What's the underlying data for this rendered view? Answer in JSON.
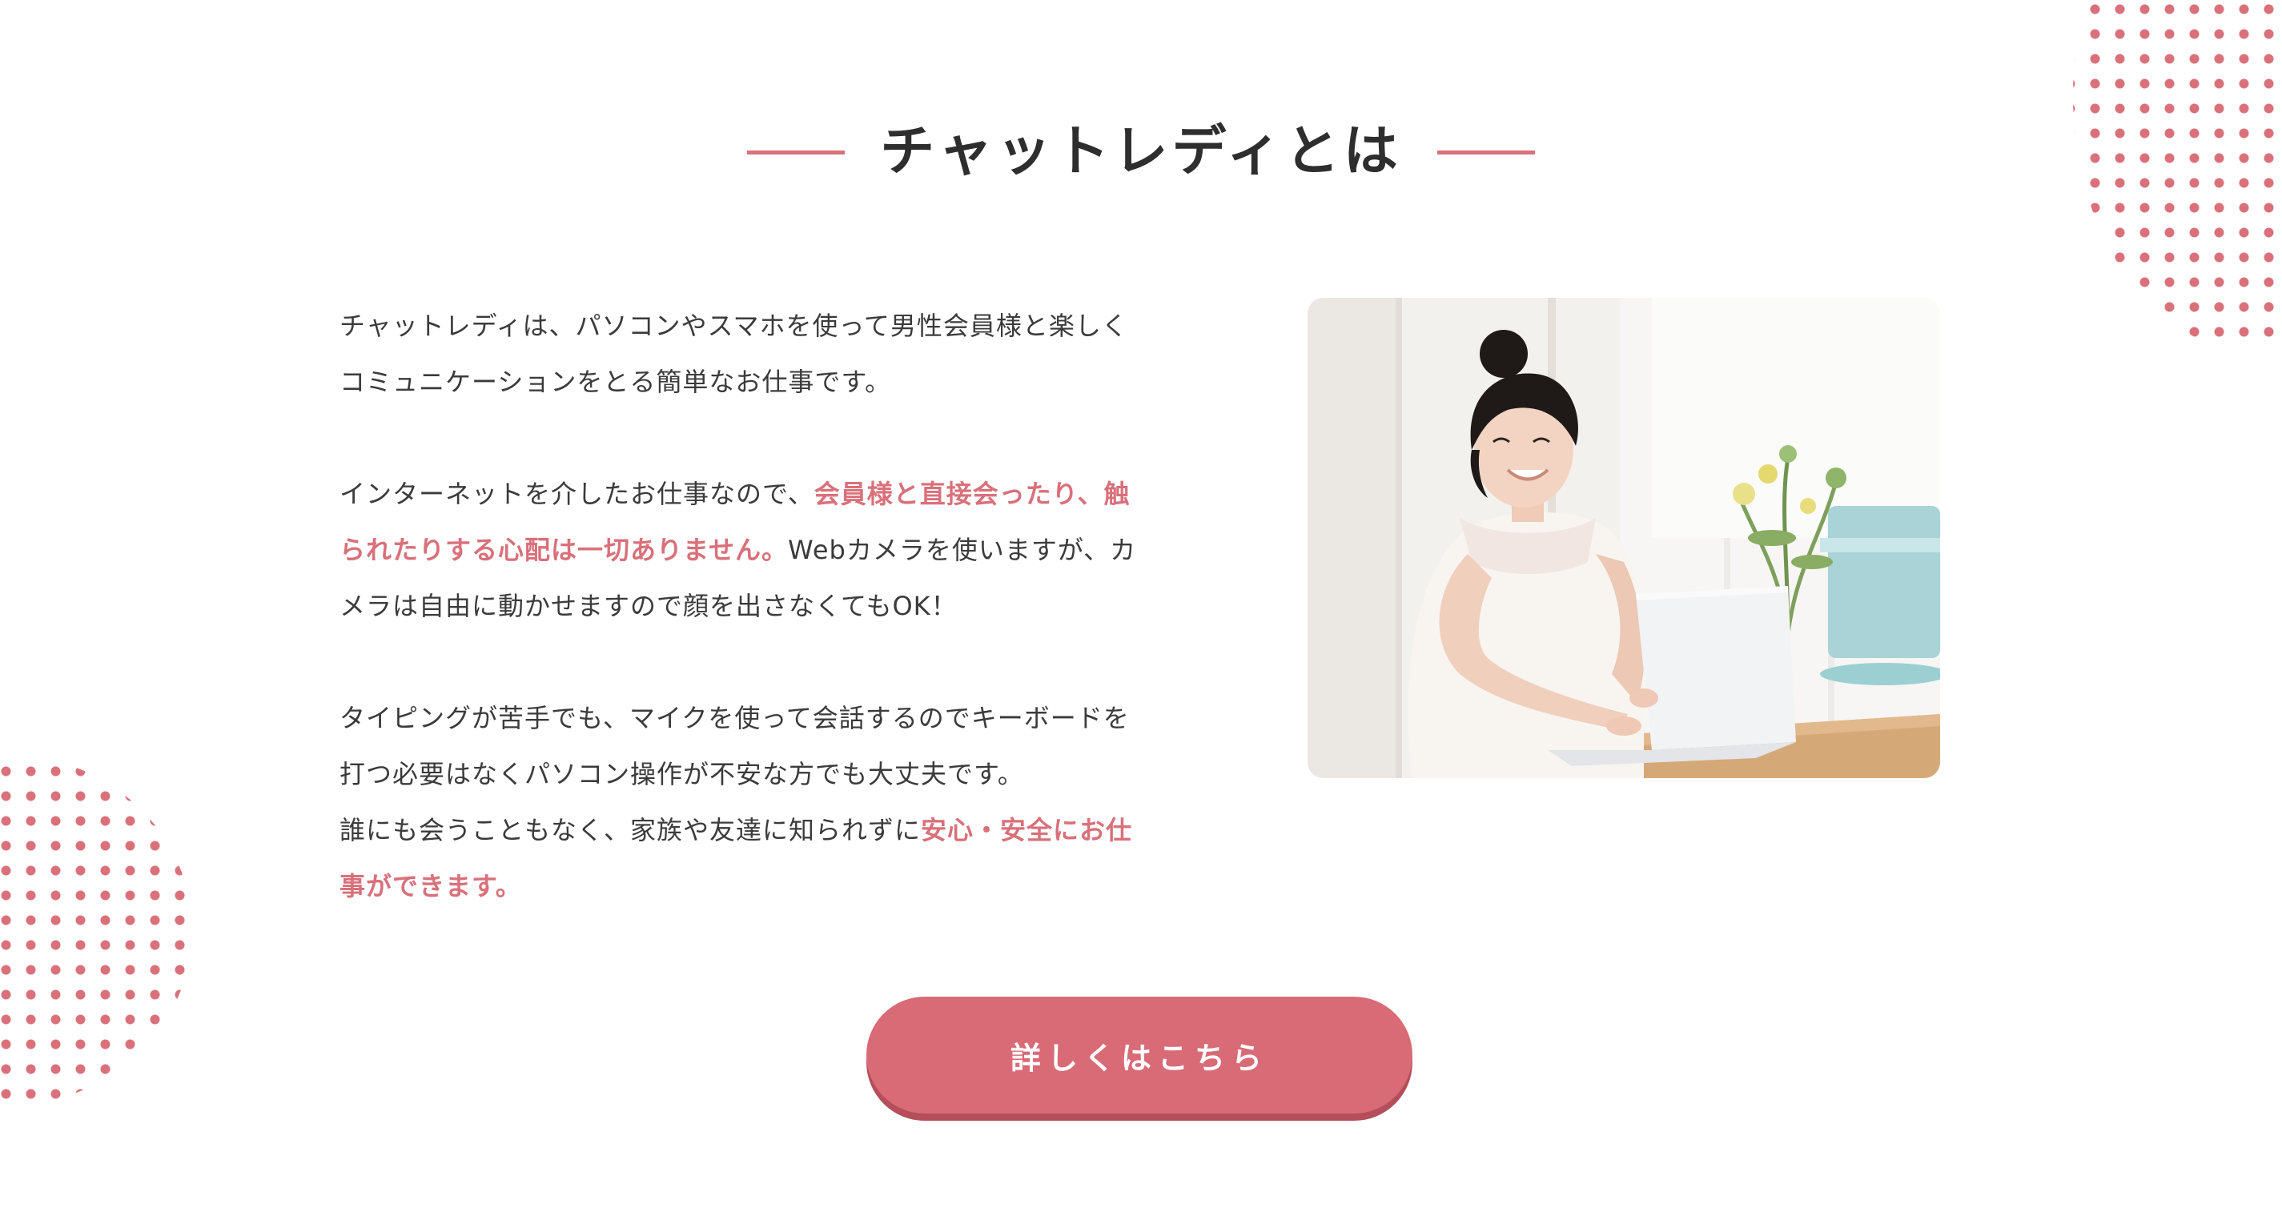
{
  "section": {
    "title": "チャットレディとは"
  },
  "paragraphs": {
    "p1": "チャットレディは、パソコンやスマホを使って男性会員様と楽しくコミュニケーションをとる簡単なお仕事です。",
    "p2_a": "インターネットを介したお仕事なので、",
    "p2_hl": "会員様と直接会ったり、触られたりする心配は一切ありません。",
    "p2_b": "Webカメラを使いますが、カメラは自由に動かせますので顔を出さなくてもOK！",
    "p3_a": "タイピングが苦手でも、マイクを使って会話するのでキーボードを打つ必要はなくパソコン操作が不安な方でも大丈夫です。",
    "p3_b": "誰にも会うこともなく、家族や友達に知られずに",
    "p3_hl": "安心・安全にお仕事ができます。"
  },
  "cta": {
    "label": "詳しくはこちら"
  },
  "colors": {
    "accent": "#d9707a",
    "button": "#d86b76",
    "button_shadow": "#b34e5a",
    "text": "#3b3b3b",
    "heading": "#2e2e2e"
  },
  "photo": {
    "icon": "woman-at-laptop-photo"
  }
}
